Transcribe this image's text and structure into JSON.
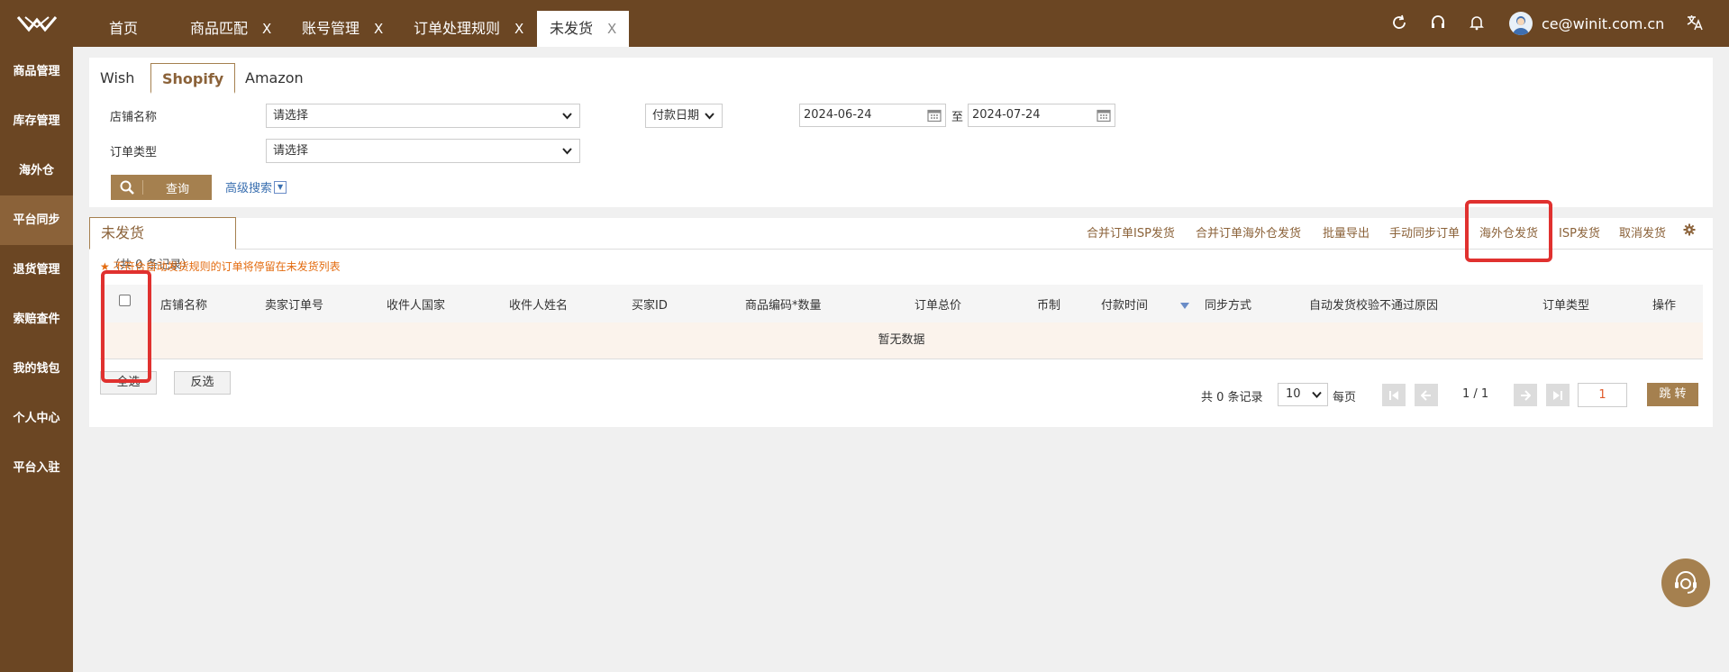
{
  "header": {
    "tabs": [
      {
        "label": "首页"
      },
      {
        "label": "商品匹配",
        "close": "X"
      },
      {
        "label": "账号管理",
        "close": "X"
      },
      {
        "label": "订单处理规则",
        "close": "X"
      },
      {
        "label": "未发货",
        "close": "X"
      }
    ],
    "user_email": "ce@winit.com.cn",
    "icons": [
      "refresh-icon",
      "headset-icon",
      "bell-icon",
      "avatar",
      "translate-icon"
    ]
  },
  "sidebar": {
    "items": [
      {
        "label": "商品管理"
      },
      {
        "label": "库存管理"
      },
      {
        "label": "海外仓"
      },
      {
        "label": "平台同步",
        "active": true
      },
      {
        "label": "退货管理"
      },
      {
        "label": "索赔查件"
      },
      {
        "label": "我的钱包"
      },
      {
        "label": "个人中心"
      },
      {
        "label": "平台入驻"
      }
    ]
  },
  "platform_tabs": [
    {
      "label": "Wish"
    },
    {
      "label": "Shopify",
      "active": true
    },
    {
      "label": "Amazon"
    }
  ],
  "filters": {
    "shop_label": "店铺名称",
    "shop_value": "请选择",
    "order_type_label": "订单类型",
    "order_type_value": "请选择",
    "date_type": "付款日期",
    "date_from": "2024-06-24",
    "date_to_label": "至",
    "date_to": "2024-07-24",
    "query_button": "查询",
    "advanced_search": "高级搜索"
  },
  "section": {
    "title": "未发货",
    "count_text": "（共 0 条记录）",
    "warning_star": "★",
    "warning": "不符合自动发货规则的订单将停留在未发货列表"
  },
  "actions": {
    "merge_isp": "合并订单ISP发货",
    "merge_overseas": "合并订单海外仓发货",
    "bulk_export": "批量导出",
    "manual_sync": "手动同步订单",
    "overseas_ship": "海外仓发货",
    "isp_ship": "ISP发货",
    "cancel_ship": "取消发货"
  },
  "table": {
    "columns": [
      "店铺名称",
      "卖家订单号",
      "收件人国家",
      "收件人姓名",
      "买家ID",
      "商品编码*数量",
      "订单总价",
      "币制",
      "付款时间",
      "同步方式",
      "自动发货校验不通过原因",
      "订单类型",
      "操作"
    ],
    "empty_text": "暂无数据"
  },
  "footer": {
    "select_all": "全选",
    "invert": "反选",
    "total_text": "共 0 条记录",
    "page_size": "10",
    "per_page": "每页",
    "page_indicator": "1 / 1",
    "page_input": "1",
    "jump": "跳 转"
  },
  "colors": {
    "brand_brown": "#6b4623",
    "accent": "#a5804f",
    "highlight_red": "#e0312f",
    "warning_orange": "#e36b0f"
  }
}
